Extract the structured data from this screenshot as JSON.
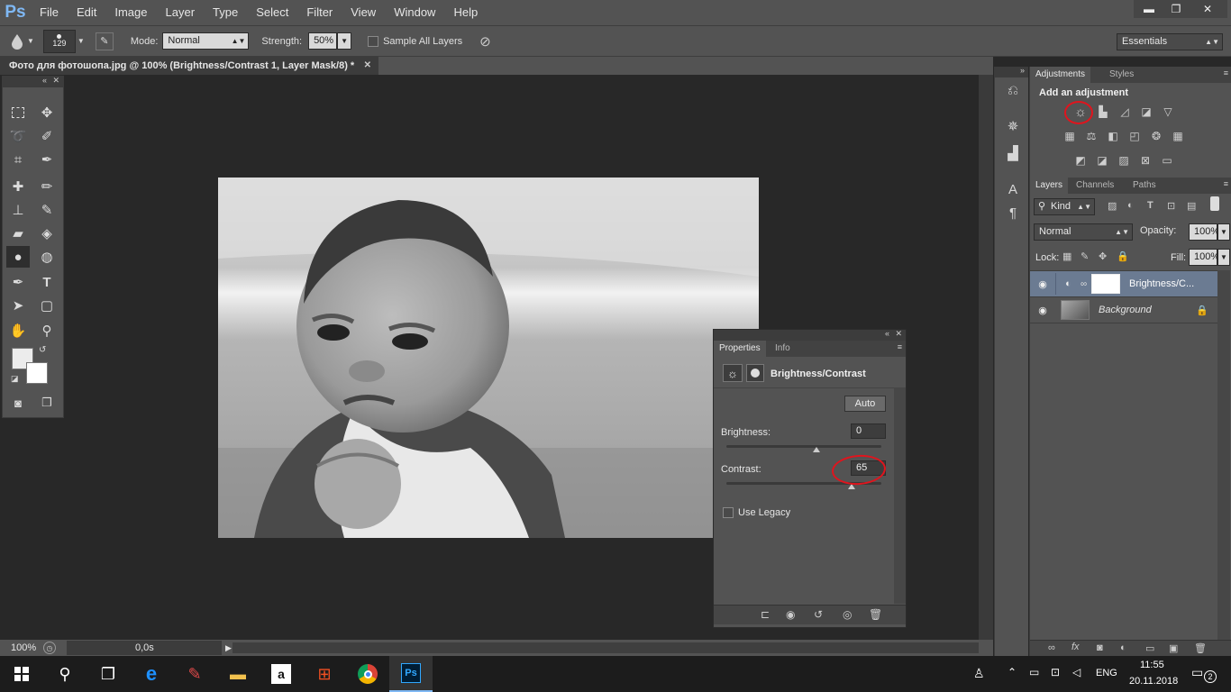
{
  "app": {
    "logo": "Ps"
  },
  "menu": [
    "File",
    "Edit",
    "Image",
    "Layer",
    "Type",
    "Select",
    "Filter",
    "View",
    "Window",
    "Help"
  ],
  "window_controls": {
    "minimize": "▬",
    "restore": "❐",
    "close": "✕"
  },
  "options": {
    "brush_size": "129",
    "mode_label": "Mode:",
    "mode_value": "Normal",
    "strength_label": "Strength:",
    "strength_value": "50%",
    "sample_all_layers": "Sample All Layers",
    "workspace": "Essentials"
  },
  "document": {
    "tab_title": "Фото для фотошопа.jpg @ 100% (Brightness/Contrast 1, Layer Mask/8) *",
    "close": "✕",
    "zoom": "100%",
    "timer": "0,0s"
  },
  "adjustments_panel": {
    "tabs": [
      "Adjustments",
      "Styles"
    ],
    "heading": "Add an adjustment"
  },
  "layers_panel": {
    "tabs": [
      "Layers",
      "Channels",
      "Paths"
    ],
    "filter_kind": "Kind",
    "blend_mode": "Normal",
    "opacity_label": "Opacity:",
    "opacity_value": "100%",
    "lock_label": "Lock:",
    "fill_label": "Fill:",
    "fill_value": "100%",
    "layers": [
      {
        "name": "Brightness/C...",
        "selected": true
      },
      {
        "name": "Background",
        "selected": false
      }
    ]
  },
  "properties_panel": {
    "tabs": [
      "Properties",
      "Info"
    ],
    "title": "Brightness/Contrast",
    "auto_button": "Auto",
    "brightness_label": "Brightness:",
    "brightness_value": "0",
    "brightness_fraction": 0.58,
    "contrast_label": "Contrast:",
    "contrast_value": "65",
    "contrast_fraction": 0.81,
    "use_legacy": "Use Legacy"
  },
  "taskbar": {
    "language": "ENG",
    "time": "11:55",
    "date": "20.11.2018",
    "notifications": "2"
  },
  "colors": {
    "panel_bg": "#535353",
    "canvas_bg": "#282828",
    "annotation_red": "#e0141d",
    "ps_blue": "#7fb8f4"
  }
}
